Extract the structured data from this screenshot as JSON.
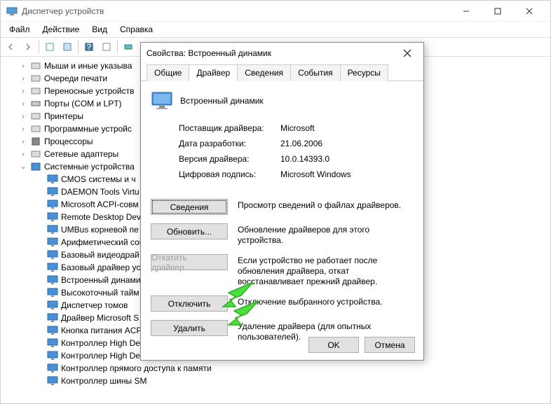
{
  "window": {
    "title": "Диспетчер устройств"
  },
  "menubar": [
    "Файл",
    "Действие",
    "Вид",
    "Справка"
  ],
  "tree": {
    "items": [
      {
        "label": "Мыши и иные указыва",
        "indent": 1,
        "exp": ">",
        "icon": "device"
      },
      {
        "label": "Очереди печати",
        "indent": 1,
        "exp": ">",
        "icon": "device"
      },
      {
        "label": "Переносные устройств",
        "indent": 1,
        "exp": ">",
        "icon": "device"
      },
      {
        "label": "Порты (COM и LPT)",
        "indent": 1,
        "exp": ">",
        "icon": "port"
      },
      {
        "label": "Принтеры",
        "indent": 1,
        "exp": ">",
        "icon": "device"
      },
      {
        "label": "Программные устройс",
        "indent": 1,
        "exp": ">",
        "icon": "device"
      },
      {
        "label": "Процессоры",
        "indent": 1,
        "exp": ">",
        "icon": "cpu"
      },
      {
        "label": "Сетевые адаптеры",
        "indent": 1,
        "exp": ">",
        "icon": "device"
      },
      {
        "label": "Системные устройства",
        "indent": 1,
        "exp": "v",
        "icon": "sys"
      },
      {
        "label": "CMOS системы и ч",
        "indent": 2,
        "icon": "mon"
      },
      {
        "label": "DAEMON Tools Virtu",
        "indent": 2,
        "icon": "mon"
      },
      {
        "label": "Microsoft ACPI-совм",
        "indent": 2,
        "icon": "mon"
      },
      {
        "label": "Remote Desktop Dev",
        "indent": 2,
        "icon": "mon"
      },
      {
        "label": "UMBus корневой пе",
        "indent": 2,
        "icon": "mon"
      },
      {
        "label": "Арифметический сог",
        "indent": 2,
        "icon": "mon"
      },
      {
        "label": "Базовый видеодрай",
        "indent": 2,
        "icon": "mon"
      },
      {
        "label": "Базовый драйвер ус",
        "indent": 2,
        "icon": "mon"
      },
      {
        "label": "Встроенный динами",
        "indent": 2,
        "icon": "mon"
      },
      {
        "label": "Высокоточный тайм",
        "indent": 2,
        "icon": "mon"
      },
      {
        "label": "Диспетчер томов",
        "indent": 2,
        "icon": "mon"
      },
      {
        "label": "Драйвер Microsoft S",
        "indent": 2,
        "icon": "mon"
      },
      {
        "label": "Кнопка питания ACP",
        "indent": 2,
        "icon": "mon"
      },
      {
        "label": "Контроллер High De",
        "indent": 2,
        "icon": "mon"
      },
      {
        "label": "Контроллер High De",
        "indent": 2,
        "icon": "mon"
      },
      {
        "label": "Контроллер прямого доступа к памяти",
        "indent": 2,
        "icon": "mon"
      },
      {
        "label": "Контроллер шины SM",
        "indent": 2,
        "icon": "mon"
      }
    ]
  },
  "dialog": {
    "title": "Свойства: Встроенный динамик",
    "tabs": [
      "Общие",
      "Драйвер",
      "Сведения",
      "События",
      "Ресурсы"
    ],
    "active_tab": 1,
    "device_name": "Встроенный динамик",
    "props": [
      {
        "label": "Поставщик драйвера:",
        "value": "Microsoft"
      },
      {
        "label": "Дата разработки:",
        "value": "21.06.2006"
      },
      {
        "label": "Версия драйвера:",
        "value": "10.0.14393.0"
      },
      {
        "label": "Цифровая подпись:",
        "value": "Microsoft Windows"
      }
    ],
    "actions": [
      {
        "label": "Сведения",
        "desc": "Просмотр сведений о файлах драйверов.",
        "disabled": false,
        "focus": true
      },
      {
        "label": "Обновить...",
        "desc": "Обновление драйверов для этого устройства.",
        "disabled": false
      },
      {
        "label": "Откатить драйвер...",
        "desc": "Если устройство не работает после обновления драйвера, откат восстанавливает прежний драйвер.",
        "disabled": true
      },
      {
        "label": "Отключить",
        "desc": "Отключение выбранного устройства.",
        "disabled": false
      },
      {
        "label": "Удалить",
        "desc": "Удаление драйвера (для опытных пользователей).",
        "disabled": false
      }
    ],
    "footer": {
      "ok": "OK",
      "cancel": "Отмена"
    }
  }
}
